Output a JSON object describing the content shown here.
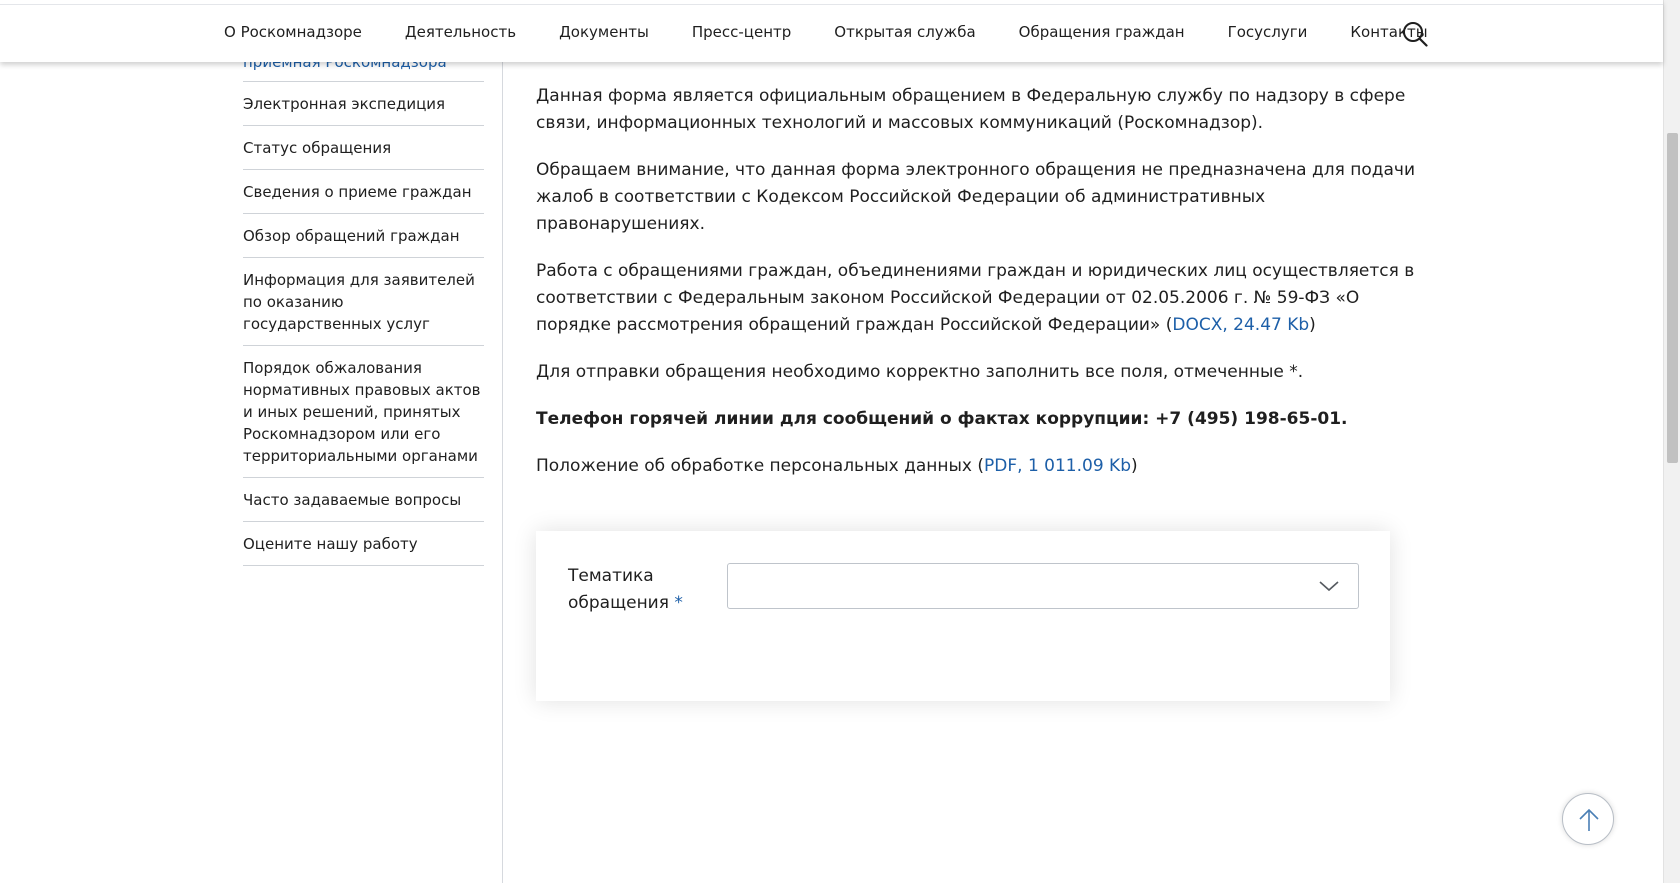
{
  "nav": {
    "items": [
      "О Роскомнадзоре",
      "Деятельность",
      "Документы",
      "Пресс-центр",
      "Открытая служба",
      "Обращения граждан",
      "Госуслуги",
      "Контакты"
    ]
  },
  "sidebar": {
    "items": [
      "приемная Роскомнадзора",
      "Электронная экспедиция",
      "Статус обращения",
      "Сведения о приеме граждан",
      "Обзор обращений граждан",
      "Информация для заявителей по оказанию государственных услуг",
      "Порядок обжалования нормативных правовых актов и иных решений, принятых Роскомнадзором или его территориальными органами",
      "Часто задаваемые вопросы",
      "Оцените нашу работу"
    ]
  },
  "content": {
    "p1": "Данная форма является официальным обращением в Федеральную службу по надзору в сфере связи, информационных технологий и массовых коммуникаций (Роскомнадзор).",
    "p2": "Обращаем внимание, что данная форма электронного обращения не предназначена для подачи жалоб в соответствии с Кодексом Российской Федерации об административных правонарушениях.",
    "p3_text": "Работа с обращениями граждан, объединениями граждан и юридических лиц осуществляется в соответствии с Федеральным законом Российской Федерации от 02.05.2006 г. № 59-ФЗ «О порядке рассмотрения обращений граждан Российской Федерации» (",
    "p3_link": "DOCX, 24.47 Kb",
    "p3_end": ")",
    "p4": "Для отправки обращения необходимо корректно заполнить все поля, отмеченные *.",
    "hotline": "Телефон горячей линии для сообщений о фактах коррупции: +7 (495) 198-65-01.",
    "p6_text": "Положение об обработке персональных данных (",
    "p6_link": "PDF, 1 011.09 Kb",
    "p6_end": ")"
  },
  "form": {
    "topic_label": "Тематика обращения",
    "required_mark": "*",
    "topic_value": ""
  },
  "colors": {
    "link": "#1d5fa8",
    "text": "#1f1f1f",
    "divider": "#cfd3d8"
  },
  "icons": {
    "search": "search-icon",
    "chevron": "chevron-down-icon",
    "scroll_top": "arrow-up-icon"
  }
}
